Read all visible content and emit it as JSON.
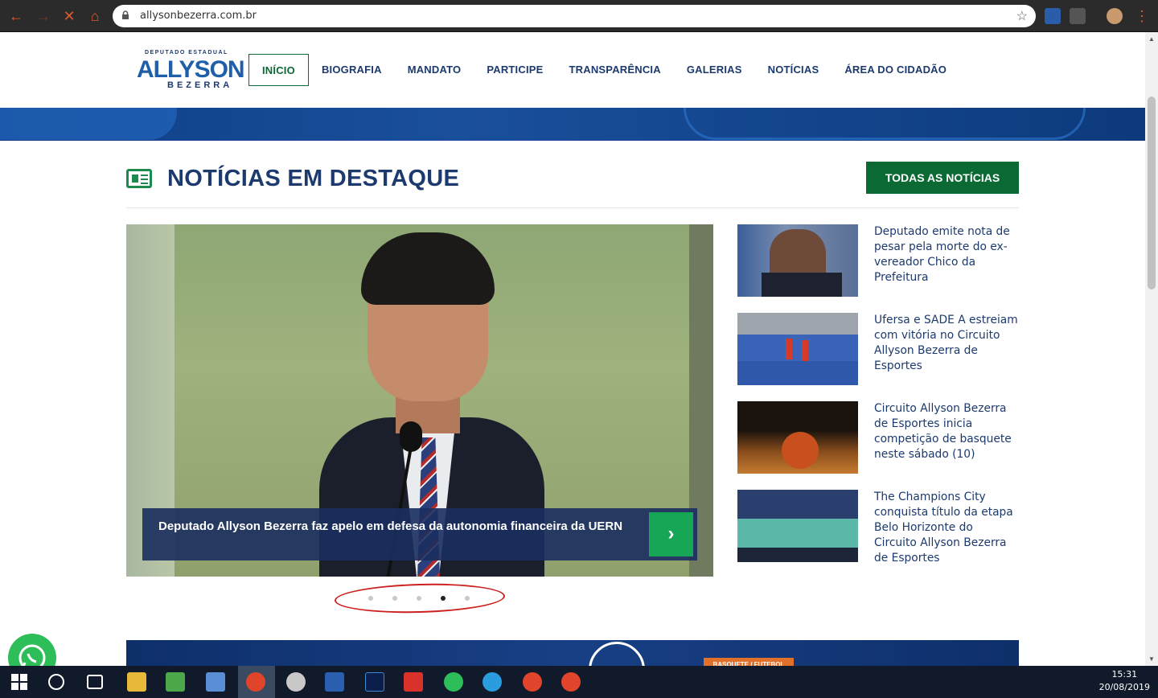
{
  "browser": {
    "url": "allysonbezerra.com.br"
  },
  "site": {
    "logo": {
      "small": "DEPUTADO ESTADUAL",
      "name": "ALLYSON",
      "sub": "BEZERRA"
    },
    "nav": [
      {
        "label": "INÍCIO",
        "active": true
      },
      {
        "label": "BIOGRAFIA",
        "active": false
      },
      {
        "label": "MANDATO",
        "active": false
      },
      {
        "label": "PARTICIPE",
        "active": false
      },
      {
        "label": "TRANSPARÊNCIA",
        "active": false
      },
      {
        "label": "GALERIAS",
        "active": false
      },
      {
        "label": "NOTÍCIAS",
        "active": false
      },
      {
        "label": "ÁREA DO CIDADÃO",
        "active": false
      }
    ]
  },
  "news": {
    "section_title": "NOTÍCIAS EM DESTAQUE",
    "all_button": "TODAS AS NOTÍCIAS",
    "featured": {
      "caption": "Deputado Allyson Bezerra faz apelo em defesa da autonomia financeira da UERN",
      "arrow": "›"
    },
    "carousel": {
      "total": 5,
      "active_index": 3
    },
    "side_items": [
      {
        "title": "Deputado emite nota de pesar pela morte do ex-vereador Chico da Prefeitura",
        "thumb": "portrait"
      },
      {
        "title": "Ufersa e SADE A estreiam com vitória no Circuito Allyson Bezerra de Esportes",
        "thumb": "futsal-court"
      },
      {
        "title": "Circuito Allyson Bezerra de Esportes inicia competição de basquete neste sábado (10)",
        "thumb": "basketball"
      },
      {
        "title": "The Champions City conquista título da etapa Belo Horizonte do Circuito Allyson Bezerra de Esportes",
        "thumb": "team-photo"
      }
    ],
    "promo_tag": "BASQUETE / FUTEBOL"
  },
  "taskbar": {
    "time": "15:31",
    "date": "20/08/2019"
  },
  "colors": {
    "navy": "#1c3a6e",
    "green": "#0b6a34",
    "accent_green": "#17a556",
    "annotation_red": "#cc2020"
  }
}
